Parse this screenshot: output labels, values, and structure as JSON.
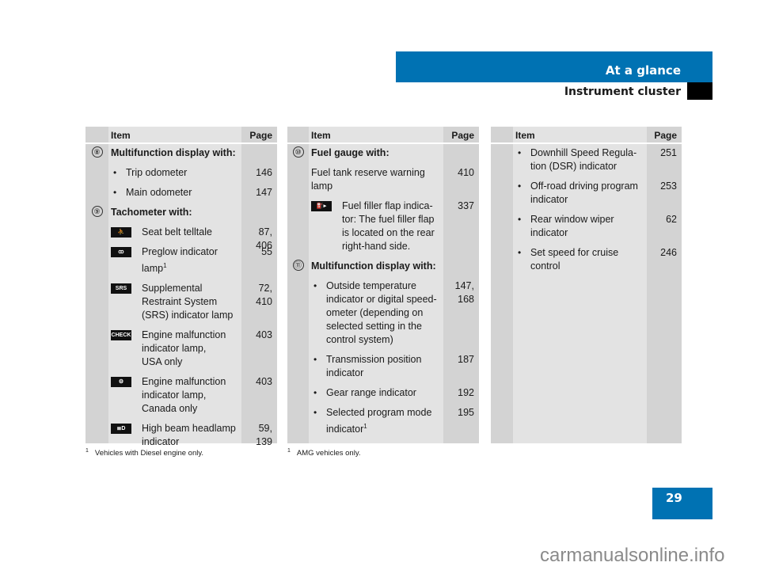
{
  "header": {
    "section": "At a glance",
    "subsection": "Instrument cluster"
  },
  "page_number": "29",
  "watermark": "carmanualsonline.info",
  "columns": {
    "item": "Item",
    "page": "Page"
  },
  "tables": [
    {
      "rows": [
        {
          "type": "head",
          "num": "8",
          "text": "Multifunction display with:",
          "page": ""
        },
        {
          "type": "bullet",
          "text": "Trip odometer",
          "page": "146"
        },
        {
          "type": "bullet",
          "text": "Main odometer",
          "page": "147"
        },
        {
          "type": "head",
          "num": "9",
          "text": "Tachometer with:",
          "page": ""
        },
        {
          "type": "icon",
          "icon": "seat-belt-icon",
          "glyph": "⛹",
          "text": "Seat belt telltale",
          "page": "87,\n406"
        },
        {
          "type": "icon",
          "icon": "preglow-icon",
          "glyph": "ꝏ",
          "text": "Preglow indicator lamp",
          "sup": "1",
          "page": "55"
        },
        {
          "type": "icon",
          "icon": "srs-icon",
          "glyph": "SRS",
          "text": "Supplemental Restraint System (SRS) indicator lamp",
          "page": "72,\n410"
        },
        {
          "type": "icon",
          "icon": "check-engine-icon",
          "glyph": "CHECK ENGINE",
          "text": "Engine malfunction indicator lamp,\nUSA only",
          "page": "403"
        },
        {
          "type": "icon",
          "icon": "engine-icon",
          "glyph": "⚙",
          "text": "Engine malfunction indicator lamp,\nCanada only",
          "page": "403"
        },
        {
          "type": "icon",
          "icon": "high-beam-icon",
          "glyph": "≣D",
          "text": "High beam headlamp indicator",
          "page": "59,\n139"
        }
      ],
      "footnote": {
        "mark": "1",
        "text": "Vehicles with Diesel engine only."
      }
    },
    {
      "rows": [
        {
          "type": "head",
          "num": "10",
          "text": "Fuel gauge with:",
          "page": ""
        },
        {
          "type": "plain",
          "text": "Fuel tank reserve warning lamp",
          "page": "410"
        },
        {
          "type": "icon",
          "icon": "fuel-filler-icon",
          "glyph": "⛽▸",
          "text": "Fuel filler flap indica-\ntor: The fuel filler flap is located on the rear right-hand side.",
          "page": "337"
        },
        {
          "type": "head",
          "num": "11",
          "text": "Multifunction display with:",
          "page": ""
        },
        {
          "type": "bullet",
          "text": "Outside temperature indicator or digital speed-\nometer (depending on selected setting in the control system)",
          "page": "147,\n168"
        },
        {
          "type": "bullet",
          "text": "Transmission position indicator",
          "page": "187"
        },
        {
          "type": "bullet",
          "text": "Gear range indicator",
          "page": "192"
        },
        {
          "type": "bullet",
          "text": "Selected program mode indicator",
          "sup": "1",
          "page": "195"
        }
      ],
      "footnote": {
        "mark": "1",
        "text": "AMG vehicles only."
      }
    },
    {
      "rows": [
        {
          "type": "bullet",
          "text": "Downhill Speed Regula-\ntion (DSR) indicator",
          "page": "251"
        },
        {
          "type": "bullet",
          "text": "Off-road driving program indicator",
          "page": "253"
        },
        {
          "type": "bullet",
          "text": "Rear window wiper indicator",
          "page": "62"
        },
        {
          "type": "bullet",
          "text": "Set speed for cruise control",
          "page": "246"
        }
      ]
    }
  ]
}
